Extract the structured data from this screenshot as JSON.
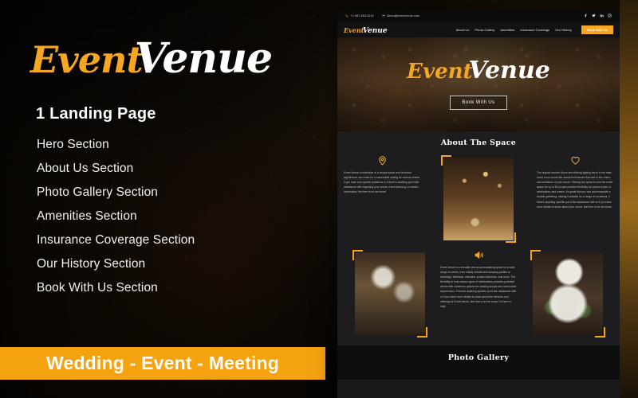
{
  "promo": {
    "logo": {
      "part1": "Event",
      "part2": "Venue"
    },
    "headline": "1 Landing Page",
    "features": [
      "Hero Section",
      "About Us Section",
      "Photo Gallery Section",
      "Amenities Section",
      "Insurance Coverage Section",
      "Our History Section",
      "Book With Us Section"
    ],
    "banner_text": "Wedding - Event - Meeting",
    "accent_color": "#f5a623",
    "banner_color": "#f5a211"
  },
  "preview": {
    "topbar": {
      "phone": "+1-987-654-3210",
      "email": "demo@eventvenue.com",
      "phone_icon": "phone-icon",
      "email_icon": "envelope-icon",
      "socials": [
        {
          "name": "facebook-icon",
          "glyph": "f"
        },
        {
          "name": "twitter-icon",
          "glyph": "t"
        },
        {
          "name": "linkedin-icon",
          "glyph": "in"
        },
        {
          "name": "instagram-icon",
          "glyph": "ig"
        }
      ]
    },
    "nav": {
      "logo": {
        "part1": "Event",
        "part2": "Venue"
      },
      "links": [
        "About Us",
        "Photo Gallery",
        "Amenities",
        "Insurance Coverage",
        "Our History"
      ],
      "cta_label": "Book With Us"
    },
    "hero": {
      "logo": {
        "part1": "Event",
        "part2": "Venue"
      },
      "button_label": "Book With Us"
    },
    "about": {
      "title": "About The Space",
      "row1": {
        "left_icon": "location-pin-icon",
        "left_text": "Event Venue combination of a unique space and historical significance can make for a memorable setting for various events. If you have any specific questions or if there's anything you'd like assistance with regarding your venue, event planning, or related information, feel free to let me know!",
        "right_icon": "heart-icon",
        "right_text": "The original wooden floors and striking lighting decor in the main event room sound like wonderful features that add to the charm and ambiance of your venue. Offering the option to rent the entire space for up to 50 people provides flexibility for various types of celebrations and events. It's great that you can accommodate a sizable gathering, making it suitable for a range of occasions. If there's anything specific you'd like assistance with or if you have more details to share about your venue, feel free to let me know!",
        "image": "dinner-table-photo"
      },
      "row2": {
        "left_image": "floral-decor-photo",
        "center_icon": "speaker-icon",
        "center_text": "Event Venue is a versatile and accommodating space for a wide range of events, from charity events and company parties to weddings, birthdays, mitzvahs, product launches, and more. The flexibility to host various types of celebrations provides potential clients with numerous options for creating unique and memorable experiences. If there's anything specific you'd like assistance with or if you have more details to share about the services and offerings at Event Venue, feel free to let me know. I'm here to help!",
        "right_image": "wedding-cake-photo"
      }
    },
    "gallery": {
      "title": "Photo Gallery"
    }
  }
}
